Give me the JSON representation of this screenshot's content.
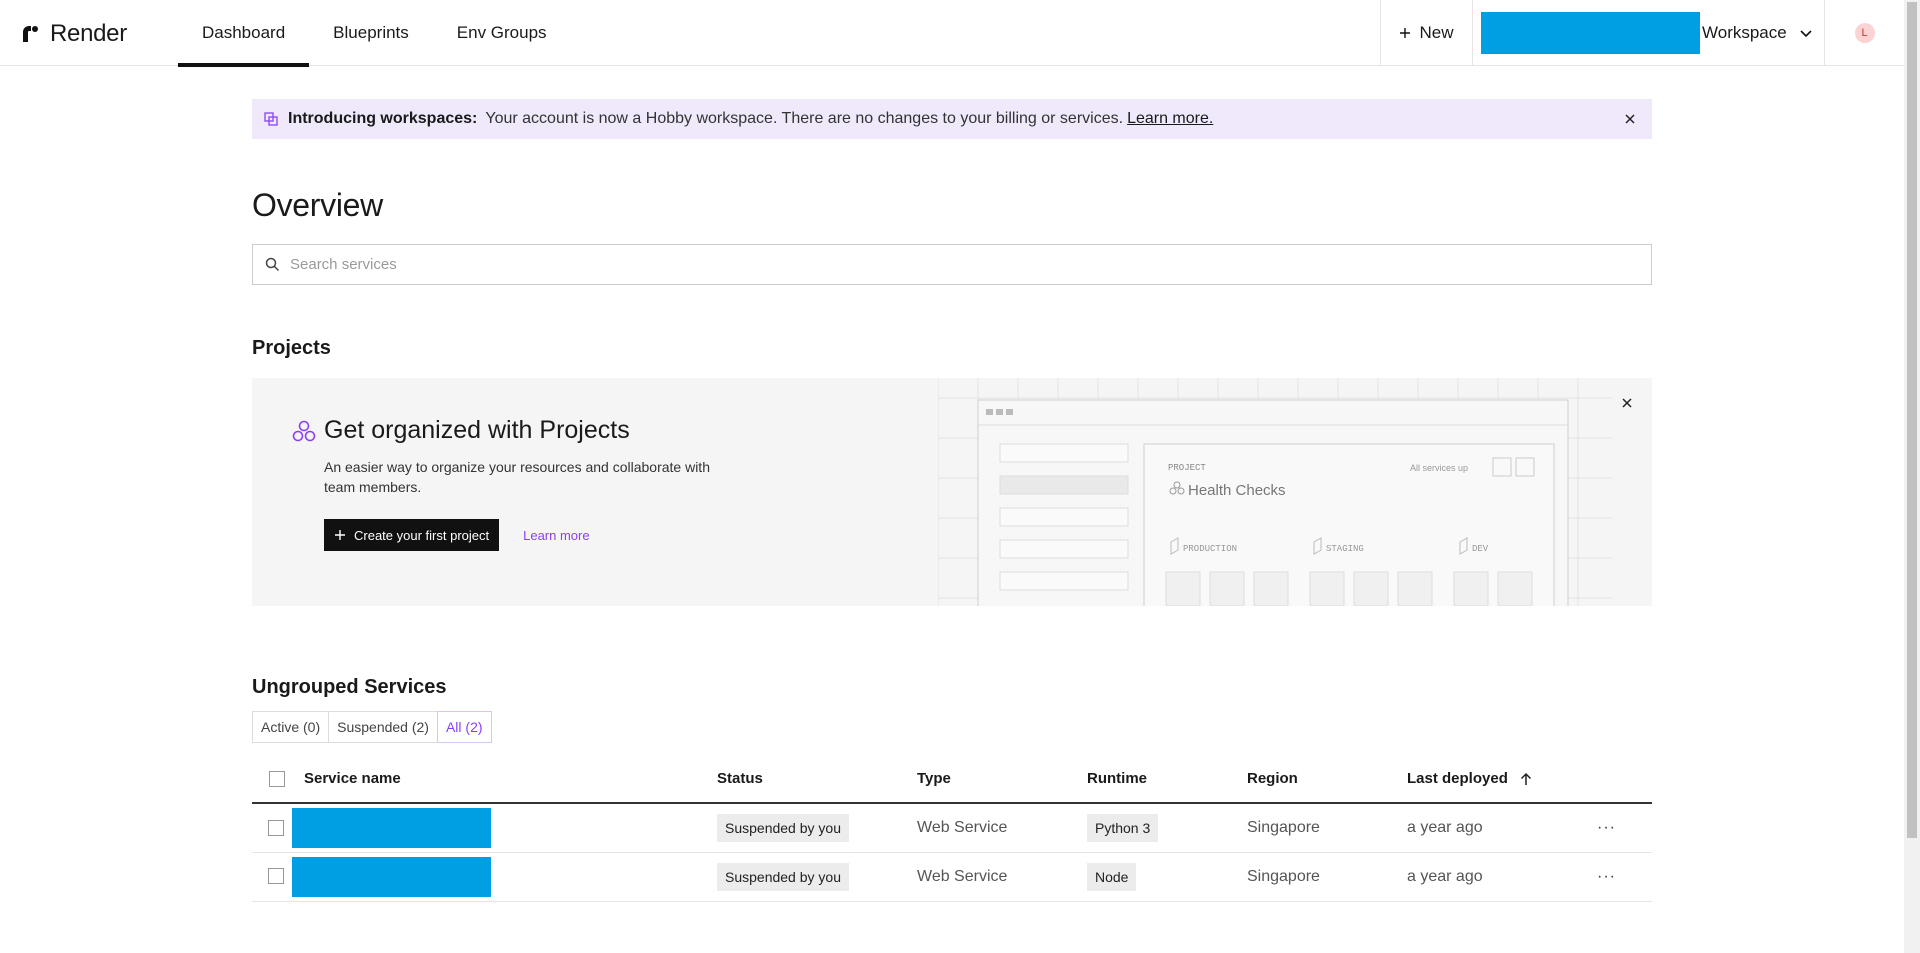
{
  "header": {
    "brand": "Render",
    "nav": [
      {
        "label": "Dashboard",
        "active": true
      },
      {
        "label": "Blueprints",
        "active": false
      },
      {
        "label": "Env Groups",
        "active": false
      }
    ],
    "new_label": "New",
    "workspace_label": "Workspace",
    "avatar_initial": "L"
  },
  "banner": {
    "title": "Introducing workspaces:",
    "message": "Your account is now a Hobby workspace. There are no changes to your billing or services.",
    "link": "Learn more."
  },
  "page": {
    "title": "Overview",
    "search_placeholder": "Search services"
  },
  "projects": {
    "title": "Projects",
    "promo_title": "Get organized with Projects",
    "promo_desc": "An easier way to organize your resources and collaborate with team members.",
    "create_label": "Create your first project",
    "learn_label": "Learn more",
    "illustration": {
      "project_label": "PROJECT",
      "project_name": "Health Checks",
      "status": "All services up",
      "envs": [
        "PRODUCTION",
        "STAGING",
        "DEV"
      ]
    }
  },
  "ungrouped": {
    "title": "Ungrouped Services",
    "filters": [
      {
        "label": "Active (0)",
        "active": false
      },
      {
        "label": "Suspended (2)",
        "active": false
      },
      {
        "label": "All (2)",
        "active": true
      }
    ],
    "columns": [
      "Service name",
      "Status",
      "Type",
      "Runtime",
      "Region",
      "Last deployed"
    ],
    "rows": [
      {
        "status": "Suspended by you",
        "type": "Web Service",
        "runtime": "Python 3",
        "region": "Singapore",
        "last_deployed": "a year ago"
      },
      {
        "status": "Suspended by you",
        "type": "Web Service",
        "runtime": "Node",
        "region": "Singapore",
        "last_deployed": "a year ago"
      }
    ],
    "more_label": "···"
  },
  "colors": {
    "accent": "#8a3ffc",
    "redaction": "#009fe3",
    "banner_bg": "#efe9fb"
  }
}
